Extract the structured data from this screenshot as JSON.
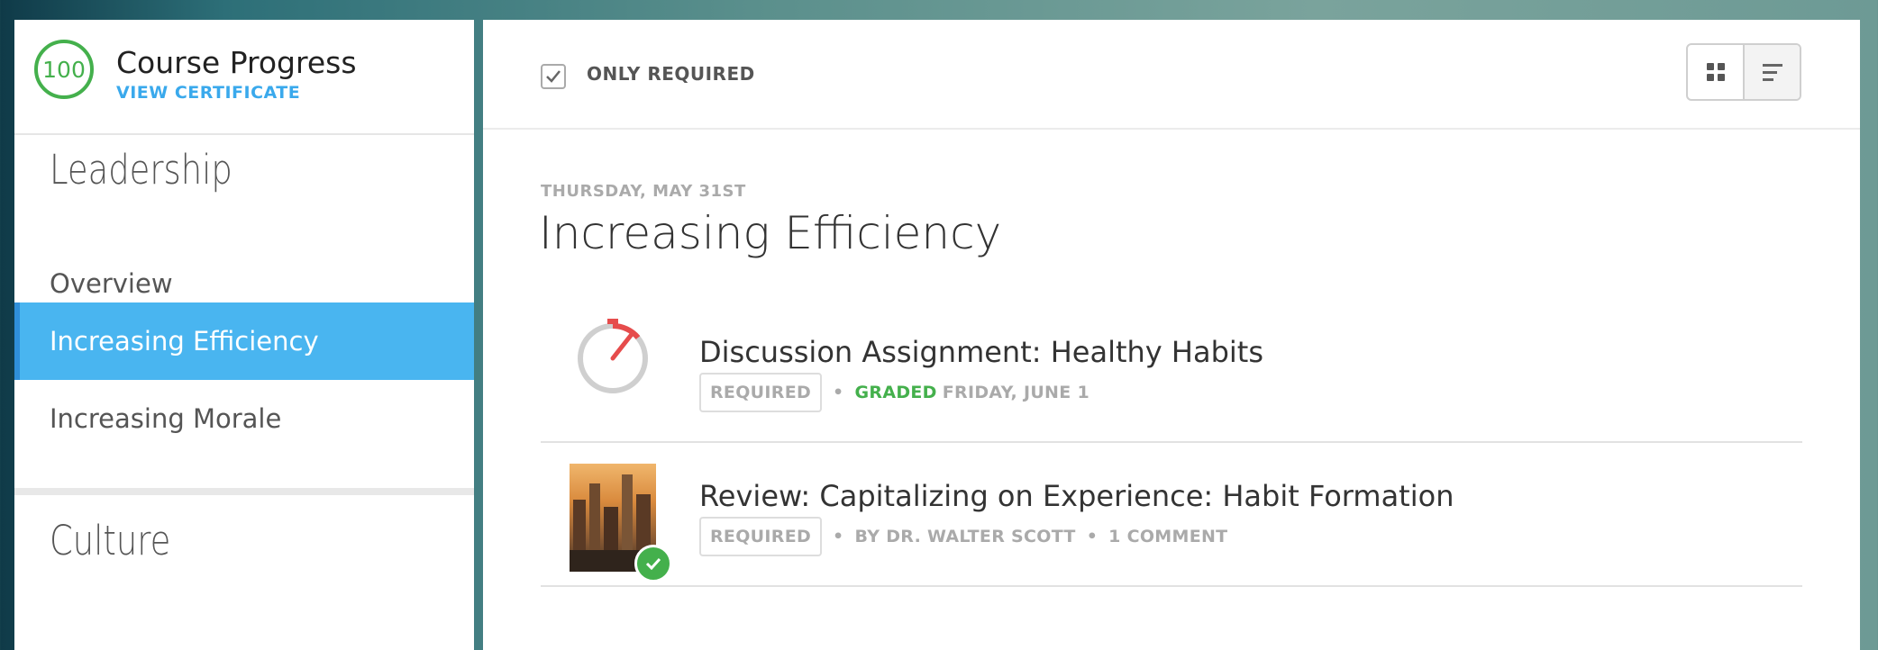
{
  "progress": {
    "value": "100",
    "title": "Course Progress",
    "certificate_link": "VIEW CERTIFICATE",
    "color": "#44b04c"
  },
  "sidebar": {
    "sections": [
      {
        "title": "Leadership",
        "items": [
          "Overview",
          "Increasing Efficiency",
          "Increasing Morale"
        ],
        "active": "Increasing Efficiency"
      },
      {
        "title": "Culture"
      }
    ]
  },
  "filter": {
    "label": "ONLY REQUIRED",
    "checked": true
  },
  "view_toggle": {
    "options": [
      "grid-icon",
      "list-icon"
    ]
  },
  "module": {
    "date": "THURSDAY, MAY 31ST",
    "title": "Increasing Efficiency",
    "items": [
      {
        "icon": "stopwatch-icon",
        "title": "Discussion Assignment: Healthy Habits",
        "badge": "REQUIRED",
        "status": "GRADED",
        "status_date": "FRIDAY, JUNE 1"
      },
      {
        "icon": "city-thumbnail",
        "title": "Review: Capitalizing on Experience: Habit Formation",
        "badge": "REQUIRED",
        "author": "BY DR. WALTER SCOTT",
        "comments": "1 COMMENT",
        "completed": true
      }
    ]
  },
  "colors": {
    "accent": "#49b5f0",
    "link": "#3aa9ec",
    "success": "#44b04c"
  }
}
